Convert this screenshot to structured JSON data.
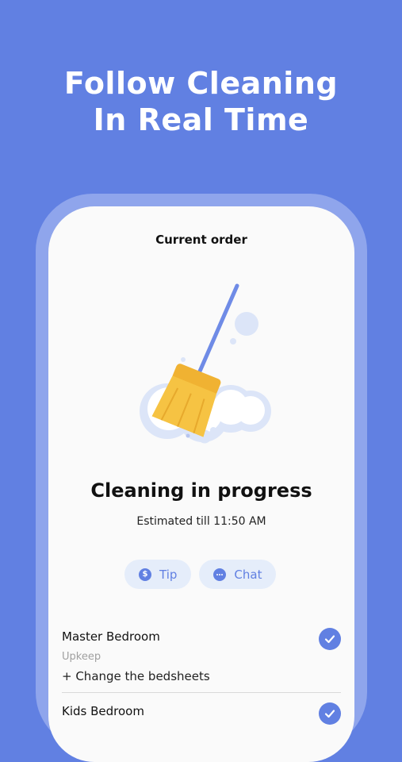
{
  "headline": {
    "line1": "Follow Cleaning",
    "line2": "In Real Time"
  },
  "screen": {
    "title": "Current order",
    "status_title": "Cleaning in progress",
    "status_subtitle": "Estimated till 11:50 AM",
    "actions": [
      {
        "label": "Tip",
        "icon": "dollar-icon"
      },
      {
        "label": "Chat",
        "icon": "chat-bubble-icon"
      }
    ],
    "rooms": [
      {
        "name": "Master Bedroom",
        "type": "Upkeep",
        "task": "+ Change the bedsheets",
        "done": true
      },
      {
        "name": "Kids Bedroom",
        "done": true
      }
    ]
  },
  "colors": {
    "background": "#6180e2",
    "accent": "#6180e2",
    "broom": "#f6c343",
    "cloud": "#dce5f8"
  }
}
